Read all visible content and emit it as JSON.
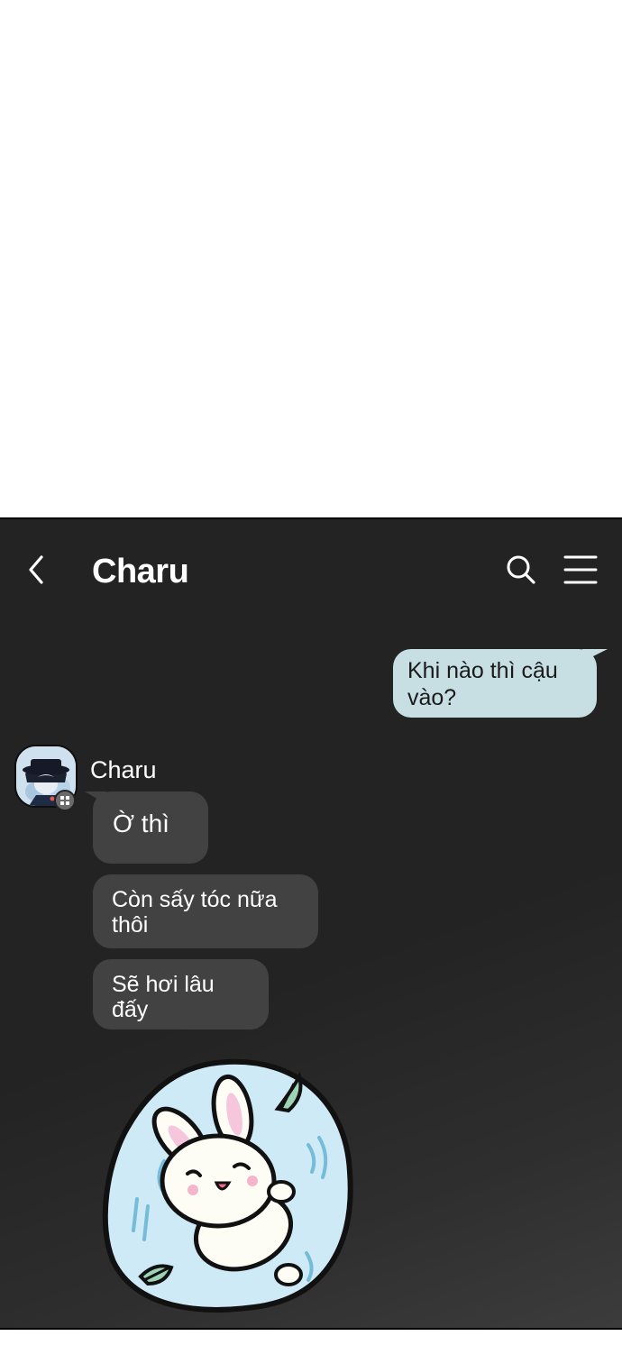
{
  "header": {
    "back_icon": "chevron-left-icon",
    "title": "Charu",
    "search_icon": "search-icon",
    "menu_icon": "hamburger-menu-icon"
  },
  "messages": {
    "outgoing": [
      {
        "text": "Khi nào thì cậu vào?"
      }
    ],
    "incoming": {
      "sender": "Charu",
      "avatar_icon": "avatar-character-icon",
      "items": [
        {
          "text": "Ờ thì"
        },
        {
          "text": "Còn sấy tóc nữa thôi"
        },
        {
          "text": "Sẽ hơi lâu đấy"
        }
      ],
      "sticker": "sleeping-bunny-sticker"
    }
  },
  "colors": {
    "chat_background": "#232323",
    "outgoing_bubble": "#c7dfe3",
    "incoming_bubble": "#424242",
    "sticker_background": "#cfeaf7"
  }
}
